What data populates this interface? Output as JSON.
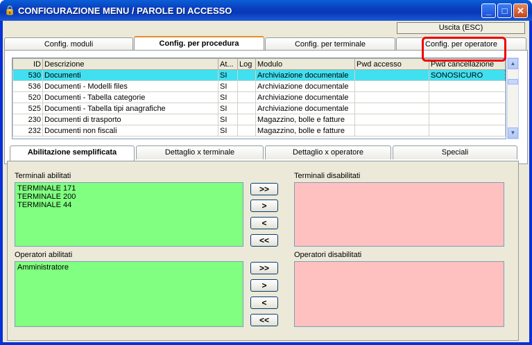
{
  "window": {
    "title": "CONFIGURAZIONE MENU / PAROLE DI ACCESSO",
    "min": "_",
    "max": "□",
    "close": "✕"
  },
  "exit_label": "Uscita (ESC)",
  "tabs": [
    "Config. moduli",
    "Config. per procedura",
    "Config. per terminale",
    "Config. per operatore"
  ],
  "grid": {
    "headers": [
      "ID",
      "Descrizione",
      "At...",
      "Log",
      "Modulo",
      "Pwd accesso",
      "Pwd cancellazione"
    ],
    "rows": [
      {
        "id": "530",
        "desc": "Documenti",
        "at": "SI",
        "log": "",
        "mod": "Archiviazione documentale",
        "pa": "",
        "pc": "SONOSICURO"
      },
      {
        "id": "536",
        "desc": "Documenti - Modelli files",
        "at": "SI",
        "log": "",
        "mod": "Archiviazione documentale",
        "pa": "",
        "pc": ""
      },
      {
        "id": "520",
        "desc": "Documenti - Tabella categorie",
        "at": "SI",
        "log": "",
        "mod": "Archiviazione documentale",
        "pa": "",
        "pc": ""
      },
      {
        "id": "525",
        "desc": "Documenti - Tabella tipi anagrafiche",
        "at": "SI",
        "log": "",
        "mod": "Archiviazione documentale",
        "pa": "",
        "pc": ""
      },
      {
        "id": "230",
        "desc": "Documenti di trasporto",
        "at": "SI",
        "log": "",
        "mod": "Magazzino, bolle e fatture",
        "pa": "",
        "pc": ""
      },
      {
        "id": "232",
        "desc": "Documenti non fiscali",
        "at": "SI",
        "log": "",
        "mod": "Magazzino, bolle e fatture",
        "pa": "",
        "pc": ""
      }
    ]
  },
  "subtabs": [
    "Abilitazione semplificata",
    "Dettaglio x terminale",
    "Dettaglio x operatore",
    "Speciali"
  ],
  "terminals": {
    "enabled_label": "Terminali abilitati",
    "disabled_label": "Terminali disabilitati",
    "enabled": [
      "TERMINALE 171",
      "TERMINALE 200",
      "TERMINALE 44"
    ]
  },
  "operators": {
    "enabled_label": "Operatori abilitati",
    "disabled_label": "Operatori disabilitati",
    "enabled": [
      "Amministratore"
    ]
  },
  "arrows": [
    ">>",
    ">",
    "<",
    "<<"
  ]
}
